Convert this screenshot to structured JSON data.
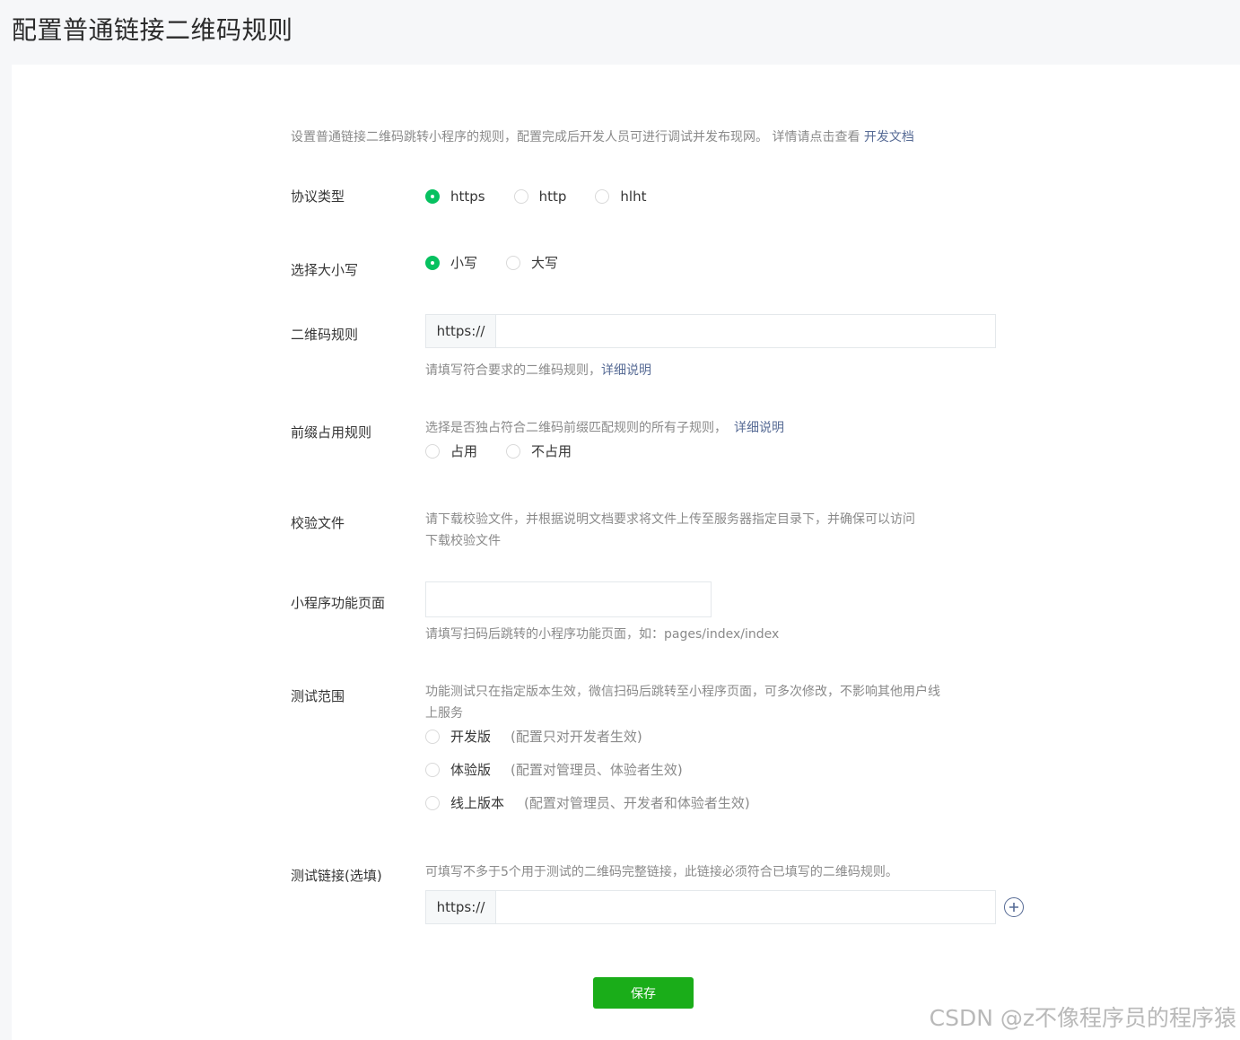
{
  "page": {
    "title": "配置普通链接二维码规则"
  },
  "intro": {
    "text": "设置普通链接二维码跳转小程序的规则，配置完成后开发人员可进行调试并发布现网。 详情请点击查看 ",
    "link": "开发文档"
  },
  "protocol": {
    "label": "协议类型",
    "options": [
      "https",
      "http",
      "hlht"
    ],
    "selected": "https"
  },
  "case": {
    "label": "选择大小写",
    "options": [
      "小写",
      "大写"
    ],
    "selected": "小写"
  },
  "qr_rule": {
    "label": "二维码规则",
    "prefix": "https://",
    "value": "",
    "hint": "请填写符合要求的二维码规则，",
    "hint_link": "详细说明"
  },
  "prefix_rule": {
    "label": "前缀占用规则",
    "hint": "选择是否独占符合二维码前缀匹配规则的所有子规则，",
    "hint_link": "详细说明",
    "options": [
      "占用",
      "不占用"
    ]
  },
  "verify_file": {
    "label": "校验文件",
    "hint": "请下载校验文件，并根据说明文档要求将文件上传至服务器指定目录下，并确保可以访问",
    "link": "下载校验文件"
  },
  "mp_page": {
    "label": "小程序功能页面",
    "value": "",
    "hint": "请填写扫码后跳转的小程序功能页面，如：pages/index/index"
  },
  "test_scope": {
    "label": "测试范围",
    "hint_line1": "功能测试只在指定版本生效，微信扫码后跳转至小程序页面，可多次修改，不影响其他用户线",
    "hint_line2": "上服务",
    "options": [
      {
        "name": "开发版",
        "note": "(配置只对开发者生效)"
      },
      {
        "name": "体验版",
        "note": "(配置对管理员、体验者生效)"
      },
      {
        "name": "线上版本",
        "note": "(配置对管理员、开发者和体验者生效)"
      }
    ]
  },
  "test_link": {
    "label": "测试链接(选填)",
    "hint": "可填写不多于5个用于测试的二维码完整链接，此链接必须符合已填写的二维码规则。",
    "prefix": "https://",
    "value": ""
  },
  "save": {
    "label": "保存"
  },
  "watermark": "CSDN @z不像程序员的程序猿",
  "colors": {
    "accent": "#07c160",
    "save_button": "#1aad19",
    "link": "#576b95"
  }
}
